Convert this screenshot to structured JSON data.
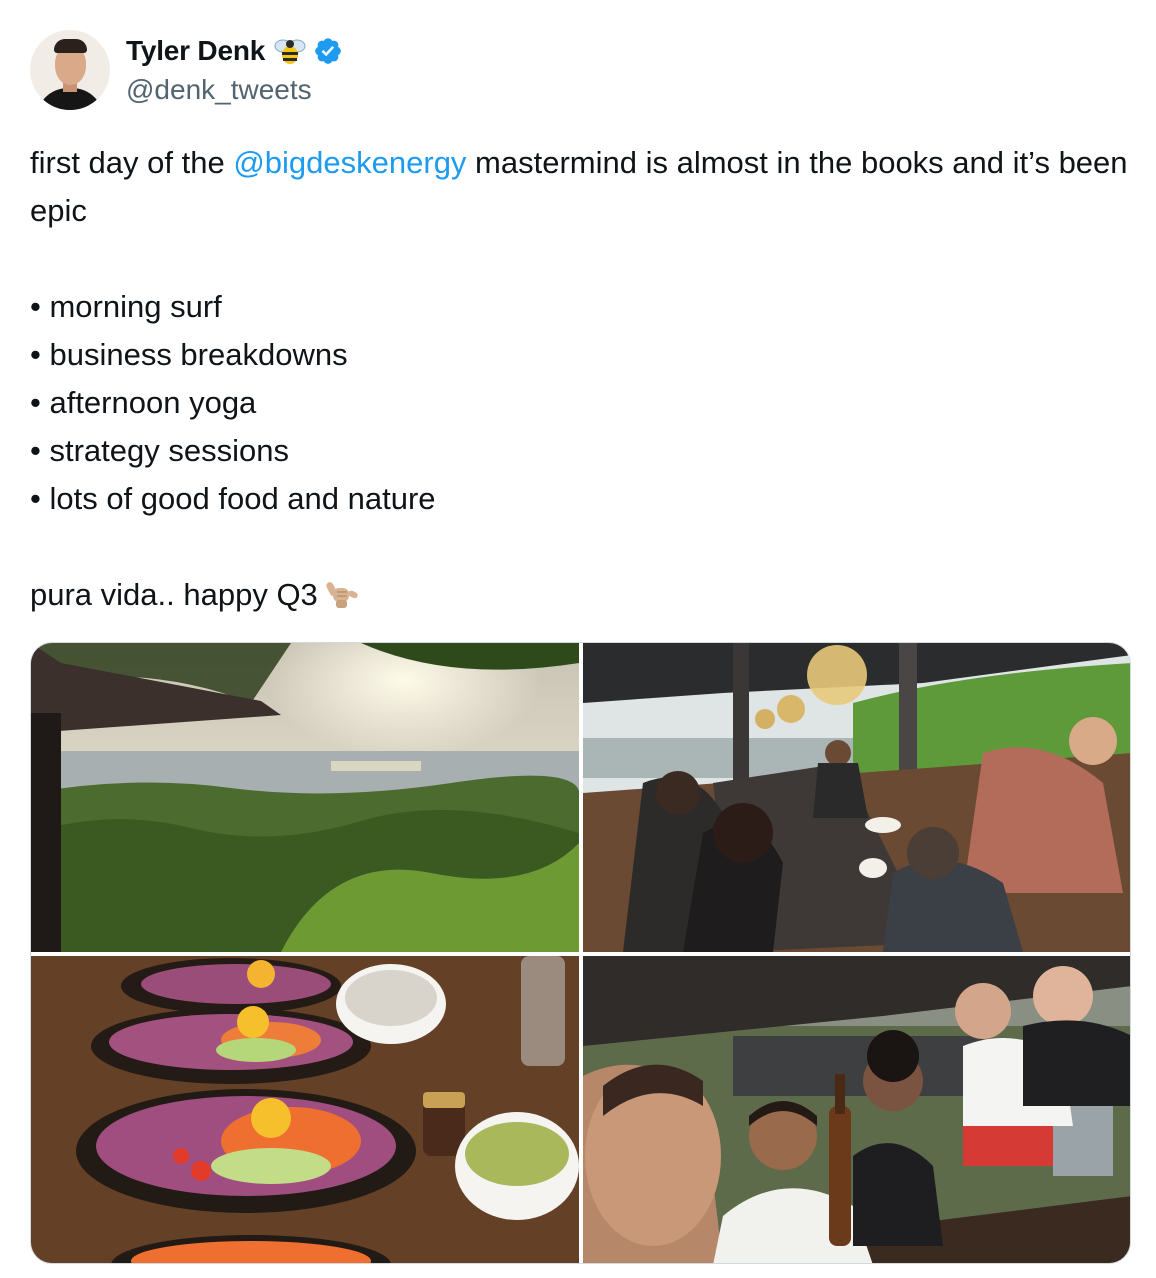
{
  "tweet": {
    "author": {
      "display_name": "Tyler Denk",
      "handle": "@denk_tweets",
      "name_emoji_icon": "bee-icon",
      "verified_icon": "verified-badge-icon",
      "verified_color": "#1d9bf0"
    },
    "text": {
      "intro_before": "first day of the ",
      "mention": "@bigdeskenergy",
      "intro_after": " mastermind is almost in the books and it’s been epic",
      "bullets": [
        "• morning surf",
        "• business breakdowns",
        "• afternoon yoga",
        "• strategy sessions",
        "• lots of good food and nature"
      ],
      "closing": "pura vida.. happy Q3",
      "closing_emoji_icon": "call-me-hand-icon"
    },
    "media": {
      "count": 4,
      "layout": "2x2-grid"
    },
    "colors": {
      "link": "#1d9bf0",
      "text": "#0f1419",
      "secondary_text": "#536471",
      "border": "#cfd9de"
    }
  }
}
